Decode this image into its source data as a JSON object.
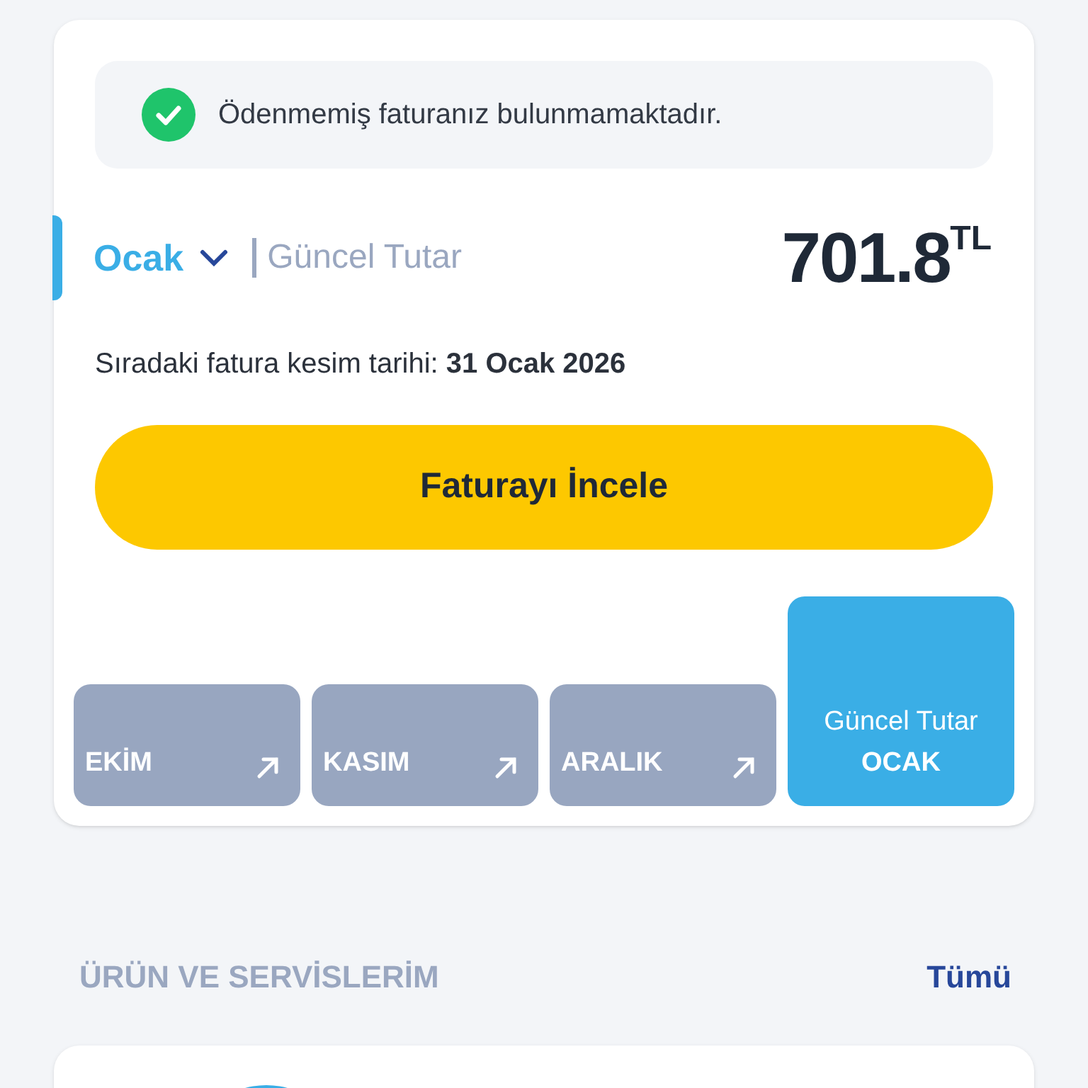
{
  "notice": {
    "text": "Ödenmemiş faturanız bulunmamaktadır."
  },
  "bill": {
    "month": "Ocak",
    "label": "Güncel Tutar",
    "amount": "701.8",
    "currency": "TL",
    "next_date_label": "Sıradaki fatura kesim tarihi:",
    "next_date": "31 Ocak 2026",
    "button": "Faturayı İncele"
  },
  "months": [
    {
      "label": "EKİM",
      "selected": false
    },
    {
      "label": "KASIM",
      "selected": false
    },
    {
      "label": "ARALIK",
      "selected": false
    },
    {
      "label": "OCAK",
      "caption": "Güncel Tutar",
      "selected": true
    }
  ],
  "section": {
    "title": "ÜRÜN VE SERVİSLERİM",
    "link": "Tümü"
  }
}
